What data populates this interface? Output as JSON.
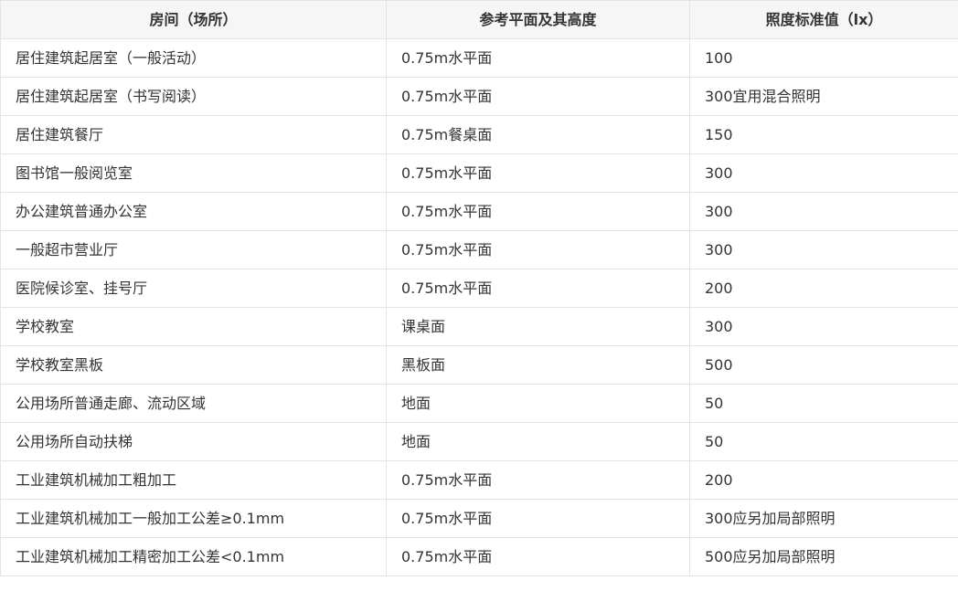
{
  "table": {
    "headers": [
      "房间（场所）",
      "参考平面及其高度",
      "照度标准值（lx）"
    ],
    "rows": [
      [
        "居住建筑起居室（一般活动）",
        "0.75m水平面",
        "100"
      ],
      [
        "居住建筑起居室（书写阅读）",
        "0.75m水平面",
        "300宜用混合照明"
      ],
      [
        "居住建筑餐厅",
        "0.75m餐桌面",
        "150"
      ],
      [
        "图书馆一般阅览室",
        "0.75m水平面",
        "300"
      ],
      [
        "办公建筑普通办公室",
        "0.75m水平面",
        "300"
      ],
      [
        "一般超市营业厅",
        "0.75m水平面",
        "300"
      ],
      [
        "医院候诊室、挂号厅",
        "0.75m水平面",
        "200"
      ],
      [
        "学校教室",
        "课桌面",
        "300"
      ],
      [
        "学校教室黑板",
        "黑板面",
        "500"
      ],
      [
        "公用场所普通走廊、流动区域",
        "地面",
        "50"
      ],
      [
        "公用场所自动扶梯",
        "地面",
        "50"
      ],
      [
        "工业建筑机械加工粗加工",
        "0.75m水平面",
        "200"
      ],
      [
        "工业建筑机械加工一般加工公差≥0.1mm",
        "0.75m水平面",
        "300应另加局部照明"
      ],
      [
        "工业建筑机械加工精密加工公差<0.1mm",
        "0.75m水平面",
        "500应另加局部照明"
      ]
    ]
  }
}
